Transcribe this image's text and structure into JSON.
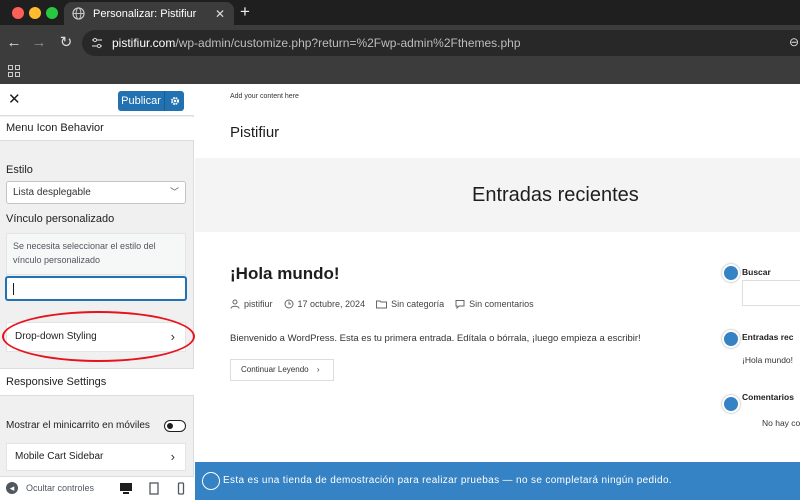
{
  "browser": {
    "tab_title": "Personalizar: Pistifiur",
    "url_host": "pistifiur.com",
    "url_path": "/wp-admin/customize.php?return=%2Fwp-admin%2Fthemes.php"
  },
  "sidebar": {
    "publish_label": "Publicar",
    "section_title": "Menu Icon Behavior",
    "estilo_label": "Estilo",
    "estilo_value": "Lista desplegable",
    "vinculo_label": "Vínculo personalizado",
    "vinculo_notice": "Se necesita seleccionar el estilo del vínculo personalizado",
    "vinculo_value": "",
    "dropdown_styling_label": "Drop-down Styling",
    "responsive_title": "Responsive Settings",
    "minicart_label": "Mostrar el minicarrito en móviles",
    "minicart_enabled": false,
    "mobile_cart_label": "Mobile Cart Sidebar",
    "hide_controls_label": "Ocultar controles"
  },
  "preview": {
    "top_text": "Add your content here",
    "site_title": "Pistifiur",
    "hero_title": "Entradas recientes",
    "post_title": "¡Hola mundo!",
    "meta": {
      "author": "pistifiur",
      "date": "17 octubre, 2024",
      "category": "Sin categoría",
      "comments": "Sin comentarios"
    },
    "excerpt": "Bienvenido a WordPress. Esta es tu primera entrada. Edítala o bórrala, ¡luego empieza a escribir!",
    "continue_label": "Continuar Leyendo",
    "widgets": {
      "search_title": "Buscar",
      "recent_title": "Entradas rec",
      "recent_item": "¡Hola mundo!",
      "comments_title": "Comentarios",
      "comments_text": "No hay co"
    },
    "store_notice": "Esta es una tienda de demostración para realizar pruebas — no se completará ningún pedido."
  },
  "colors": {
    "accent": "#2271b1",
    "store_bar": "#3582c4",
    "highlight": "#e8121c"
  }
}
